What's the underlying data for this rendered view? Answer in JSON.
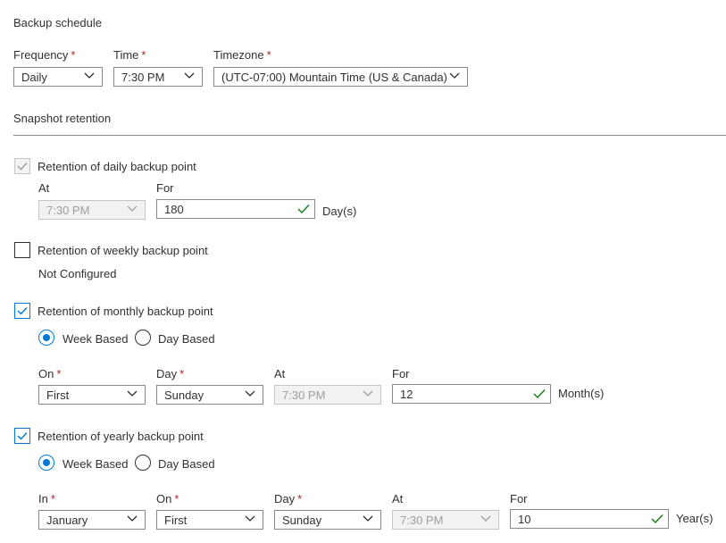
{
  "backup_schedule": {
    "title": "Backup schedule",
    "frequency": {
      "label": "Frequency",
      "value": "Daily"
    },
    "time": {
      "label": "Time",
      "value": "7:30 PM"
    },
    "timezone": {
      "label": "Timezone",
      "value": "(UTC-07:00) Mountain Time (US & Canada)"
    }
  },
  "snapshot_retention": {
    "title": "Snapshot retention",
    "daily": {
      "label": "Retention of daily backup point",
      "checked": true,
      "disabled": true,
      "at_label": "At",
      "at_value": "7:30 PM",
      "for_label": "For",
      "for_value": "180",
      "unit": "Day(s)"
    },
    "weekly": {
      "label": "Retention of weekly backup point",
      "checked": false,
      "status": "Not Configured"
    },
    "monthly": {
      "label": "Retention of monthly backup point",
      "checked": true,
      "radio_week": "Week Based",
      "radio_day": "Day Based",
      "selected": "week",
      "on_label": "On",
      "on_value": "First",
      "day_label": "Day",
      "day_value": "Sunday",
      "at_label": "At",
      "at_value": "7:30 PM",
      "for_label": "For",
      "for_value": "12",
      "unit": "Month(s)"
    },
    "yearly": {
      "label": "Retention of yearly backup point",
      "checked": true,
      "radio_week": "Week Based",
      "radio_day": "Day Based",
      "selected": "week",
      "in_label": "In",
      "in_value": "January",
      "on_label": "On",
      "on_value": "First",
      "day_label": "Day",
      "day_value": "Sunday",
      "at_label": "At",
      "at_value": "7:30 PM",
      "for_label": "For",
      "for_value": "10",
      "unit": "Year(s)"
    }
  },
  "required_marker": "*",
  "colors": {
    "accent": "#0078d4",
    "valid_check": "#107c10",
    "required": "#a4262c"
  }
}
